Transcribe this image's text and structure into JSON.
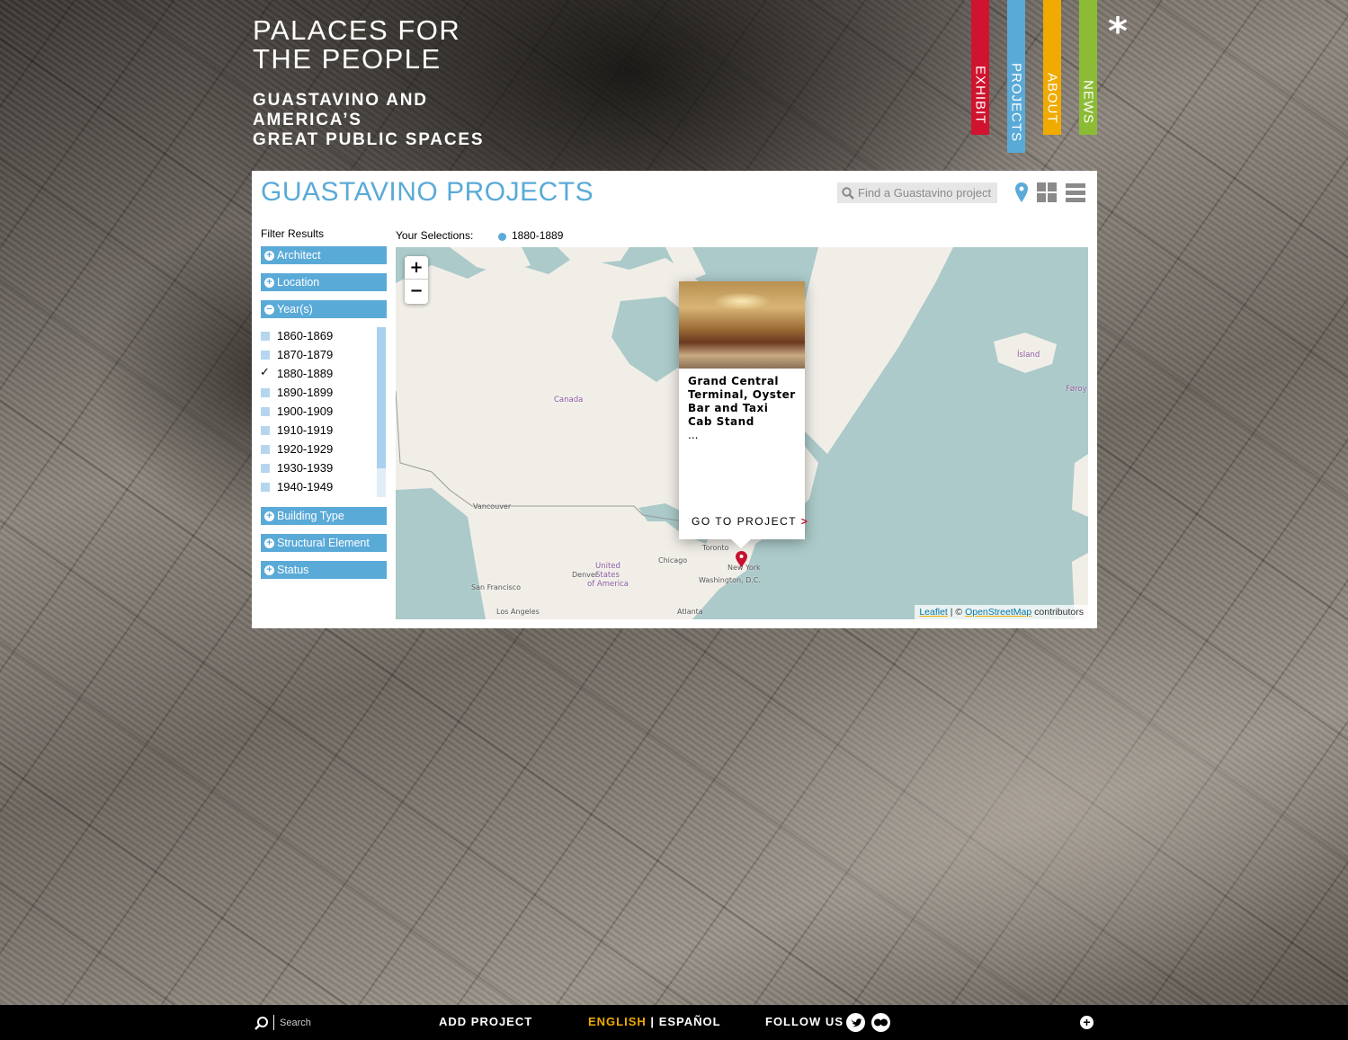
{
  "header": {
    "title_line1": "PALACES FOR",
    "title_line2": "THE PEOPLE",
    "subtitle_line1": "GUASTAVINO AND",
    "subtitle_line2": "AMERICA’S",
    "subtitle_line3": "GREAT PUBLIC SPACES"
  },
  "nav": {
    "tabs": [
      {
        "label": "EXHIBIT",
        "color": "#d0142f"
      },
      {
        "label": "PROJECTS",
        "color": "#5aaad8"
      },
      {
        "label": "ABOUT",
        "color": "#f0aa00"
      },
      {
        "label": "NEWS",
        "color": "#8cbb35"
      }
    ],
    "asterisk": "*"
  },
  "panel": {
    "title": "GUASTAVINO PROJECTS",
    "search_placeholder": "Find a Guastavino project",
    "view_icons": [
      "map-pin-icon",
      "grid-view-icon",
      "list-view-icon"
    ]
  },
  "filters": {
    "heading": "Filter Results",
    "groups": [
      {
        "label": "Architect",
        "state": "collapsed"
      },
      {
        "label": "Location",
        "state": "collapsed"
      },
      {
        "label": "Year(s)",
        "state": "expanded"
      },
      {
        "label": "Building Type",
        "state": "collapsed"
      },
      {
        "label": "Structural Element",
        "state": "collapsed"
      },
      {
        "label": "Status",
        "state": "collapsed"
      }
    ],
    "years": [
      {
        "label": "1860-1869",
        "checked": false
      },
      {
        "label": "1870-1879",
        "checked": false
      },
      {
        "label": "1880-1889",
        "checked": true
      },
      {
        "label": "1890-1899",
        "checked": false
      },
      {
        "label": "1900-1909",
        "checked": false
      },
      {
        "label": "1910-1919",
        "checked": false
      },
      {
        "label": "1920-1929",
        "checked": false
      },
      {
        "label": "1930-1939",
        "checked": false
      },
      {
        "label": "1940-1949",
        "checked": false
      }
    ]
  },
  "selections": {
    "label": "Your Selections:",
    "items": [
      "1880-1889"
    ]
  },
  "map": {
    "zoom_in": "+",
    "zoom_out": "−",
    "labels": {
      "canada": "Canada",
      "usa1": "United",
      "usa2": "States",
      "usa3": "of America",
      "iceland": "Ísland",
      "faroe": "Føroy",
      "vancouver": "Vancouver",
      "sanfrancisco": "San Francisco",
      "losangeles": "Los Angeles",
      "denver": "Denver",
      "chicago": "Chicago",
      "toronto": "Toronto",
      "newyork": "New York",
      "washington": "Washington, D.C.",
      "atlanta": "Atlanta"
    },
    "attribution": {
      "leaflet": "Leaflet",
      "sep": " | © ",
      "osm": "OpenStreetMap",
      "suffix": " contributors"
    },
    "popup": {
      "title": "Grand Central Terminal, Oyster Bar and Taxi Cab Stand",
      "ellipsis": "...",
      "link": "GO TO PROJECT",
      "chevron": ">"
    },
    "marker_color": "#c8102e"
  },
  "footer": {
    "search_label": "Search",
    "add_project": "ADD PROJECT",
    "lang_en": "ENGLISH",
    "lang_sep": "|",
    "lang_es": "ESPAÑOL",
    "follow_us": "FOLLOW US",
    "plus": "+"
  },
  "colors": {
    "accent_blue": "#5aaad8",
    "accent_orange": "#f0aa00",
    "accent_red": "#d0142f",
    "accent_green": "#8cbb35"
  }
}
